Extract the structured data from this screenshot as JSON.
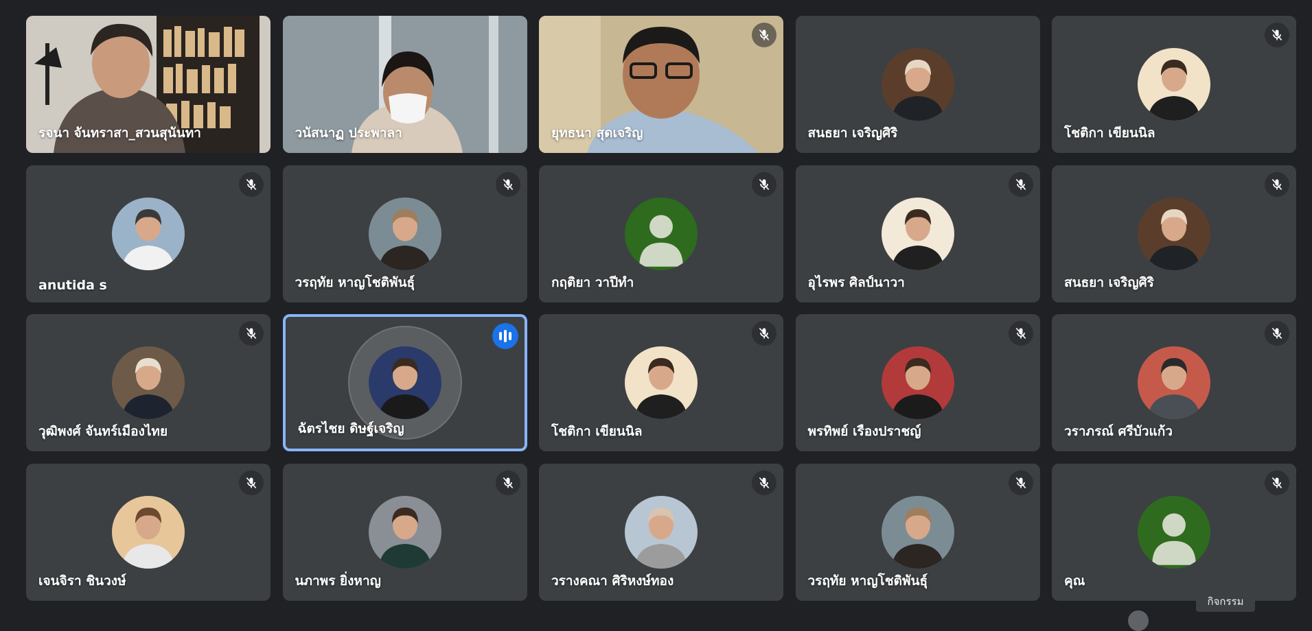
{
  "participants": [
    {
      "name": "รจนา จันทราสา_สวนสุนันทา",
      "type": "video",
      "muted": false,
      "speaking": false,
      "icon": "webcam-video"
    },
    {
      "name": "วนัสนาฏ ประพาลา",
      "type": "video",
      "muted": false,
      "speaking": false,
      "icon": "webcam-video"
    },
    {
      "name": "ยุทธนา สุดเจริญ",
      "type": "video",
      "muted": true,
      "speaking": false,
      "icon": "webcam-video"
    },
    {
      "name": "สนธยา เจริญศิริ",
      "type": "avatar",
      "muted": false,
      "speaking": false,
      "icon": "profile-photo"
    },
    {
      "name": "โชติกา เขียนนิล",
      "type": "avatar",
      "muted": true,
      "speaking": false,
      "icon": "profile-photo"
    },
    {
      "name": "anutida s",
      "type": "avatar",
      "muted": true,
      "speaking": false,
      "icon": "profile-photo"
    },
    {
      "name": "วรฤทัย หาญโชติพันธุ์",
      "type": "avatar",
      "muted": true,
      "speaking": false,
      "icon": "profile-photo"
    },
    {
      "name": "กฤติยา วาปีทำ",
      "type": "placeholder",
      "muted": true,
      "speaking": false,
      "icon": "default-person"
    },
    {
      "name": "อุไรพร ศิลป์นาวา",
      "type": "avatar",
      "muted": true,
      "speaking": false,
      "icon": "profile-photo"
    },
    {
      "name": "สนธยา เจริญศิริ",
      "type": "avatar",
      "muted": true,
      "speaking": false,
      "icon": "profile-photo"
    },
    {
      "name": "วุฒิพงศ์ จันทร์เมืองไทย",
      "type": "avatar",
      "muted": true,
      "speaking": false,
      "icon": "profile-photo"
    },
    {
      "name": "ฉัตรไชย ดิษฐ์เจริญ",
      "type": "avatar",
      "muted": false,
      "speaking": true,
      "icon": "profile-photo"
    },
    {
      "name": "โชติกา เขียนนิล",
      "type": "avatar",
      "muted": true,
      "speaking": false,
      "icon": "profile-photo"
    },
    {
      "name": "พรทิพย์ เรืองปราชญ์",
      "type": "avatar",
      "muted": true,
      "speaking": false,
      "icon": "profile-photo"
    },
    {
      "name": "วราภรณ์ ศรีบัวแก้ว",
      "type": "avatar",
      "muted": true,
      "speaking": false,
      "icon": "profile-photo"
    },
    {
      "name": "เจนจิรา ชินวงษ์",
      "type": "avatar",
      "muted": true,
      "speaking": false,
      "icon": "profile-photo"
    },
    {
      "name": "นภาพร ยิ่งหาญ",
      "type": "avatar",
      "muted": true,
      "speaking": false,
      "icon": "profile-photo"
    },
    {
      "name": "วรางคณา ศิริหงษ์ทอง",
      "type": "avatar",
      "muted": true,
      "speaking": false,
      "icon": "profile-photo"
    },
    {
      "name": "วรฤทัย หาญโชติพันธุ์",
      "type": "avatar",
      "muted": true,
      "speaking": false,
      "icon": "profile-photo"
    },
    {
      "name": "คุณ",
      "type": "placeholder",
      "muted": true,
      "speaking": false,
      "icon": "default-person"
    }
  ],
  "tooltip": {
    "label": "กิจกรรม"
  },
  "colors": {
    "background": "#202124",
    "tile": "#3c4043",
    "speaking_border": "#8ab4f8",
    "speaking_badge": "#1a73e8",
    "placeholder_avatar": "#2e6b1e"
  }
}
